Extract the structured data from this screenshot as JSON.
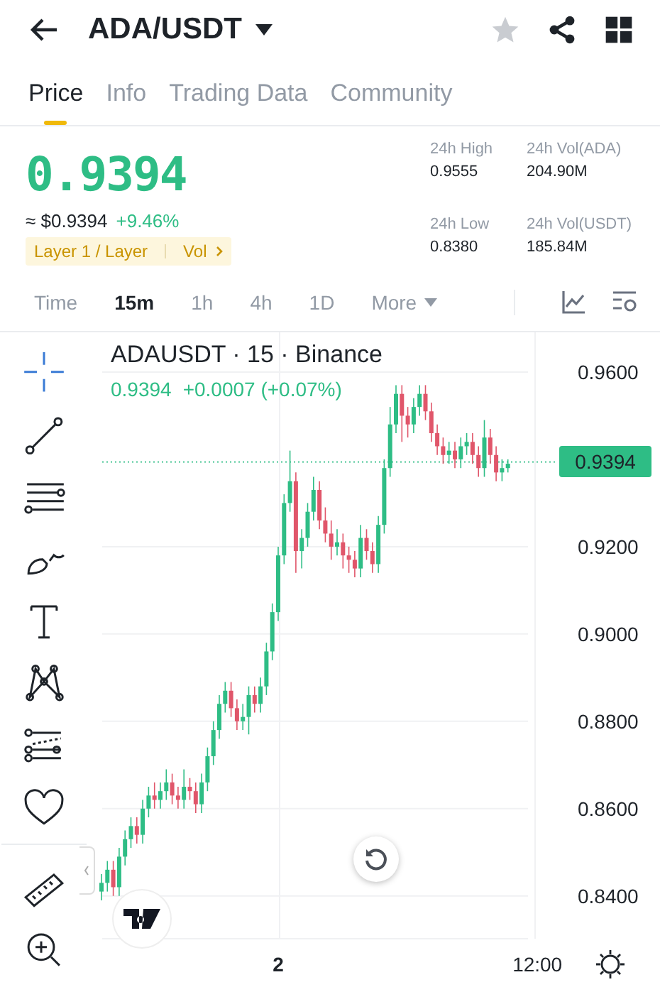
{
  "header": {
    "title": "ADA/USDT",
    "favorite": false
  },
  "tabs": [
    {
      "label": "Price",
      "selected": true
    },
    {
      "label": "Info",
      "selected": false
    },
    {
      "label": "Trading Data",
      "selected": false
    },
    {
      "label": "Community",
      "selected": false
    }
  ],
  "price": {
    "last": "0.9394",
    "usd": "≈ $0.9394",
    "change": "+9.46%",
    "tag": "Layer 1 / Layer",
    "tag_link": "Vol"
  },
  "stats": [
    {
      "label": "24h High",
      "value": "0.9555"
    },
    {
      "label": "24h Vol(ADA)",
      "value": "204.90M"
    },
    {
      "label": "24h Low",
      "value": "0.8380"
    },
    {
      "label": "24h Vol(USDT)",
      "value": "185.84M"
    }
  ],
  "intervals": [
    {
      "label": "Time",
      "selected": false
    },
    {
      "label": "15m",
      "selected": true
    },
    {
      "label": "1h",
      "selected": false
    },
    {
      "label": "4h",
      "selected": false
    },
    {
      "label": "1D",
      "selected": false
    },
    {
      "label": "More",
      "selected": false
    }
  ],
  "chart": {
    "title": "ADAUSDT · 15 · Binance",
    "legend_price": "0.9394",
    "legend_change": "+0.0007 (+0.07%)",
    "chart_data": {
      "type": "candlestick",
      "categories": [
        null,
        null,
        null,
        null,
        null,
        null,
        null,
        null,
        null,
        null,
        null,
        null,
        null,
        null,
        null,
        null,
        null,
        null,
        null,
        null,
        null,
        null,
        null,
        null,
        null,
        null,
        null,
        null,
        null,
        null,
        "2",
        null,
        null,
        null,
        null,
        null,
        null,
        null,
        null,
        null,
        null,
        null,
        null,
        null,
        null,
        null,
        null,
        null,
        null,
        null,
        null,
        null,
        null,
        null,
        null,
        null,
        null,
        null,
        null,
        null,
        null,
        null,
        null,
        null,
        null,
        null,
        null,
        null,
        null,
        null,
        null,
        null,
        null,
        null,
        "12:00"
      ],
      "ohlc": [
        [
          0.841,
          0.845,
          0.839,
          0.843
        ],
        [
          0.843,
          0.848,
          0.841,
          0.846
        ],
        [
          0.846,
          0.848,
          0.84,
          0.842
        ],
        [
          0.842,
          0.851,
          0.84,
          0.849
        ],
        [
          0.849,
          0.855,
          0.847,
          0.853
        ],
        [
          0.853,
          0.858,
          0.851,
          0.856
        ],
        [
          0.856,
          0.858,
          0.852,
          0.854
        ],
        [
          0.854,
          0.862,
          0.852,
          0.86
        ],
        [
          0.86,
          0.865,
          0.858,
          0.863
        ],
        [
          0.863,
          0.866,
          0.86,
          0.862
        ],
        [
          0.862,
          0.866,
          0.86,
          0.864
        ],
        [
          0.864,
          0.869,
          0.862,
          0.866
        ],
        [
          0.866,
          0.868,
          0.861,
          0.863
        ],
        [
          0.863,
          0.865,
          0.86,
          0.862
        ],
        [
          0.862,
          0.869,
          0.86,
          0.865
        ],
        [
          0.865,
          0.867,
          0.862,
          0.864
        ],
        [
          0.864,
          0.866,
          0.859,
          0.861
        ],
        [
          0.861,
          0.868,
          0.859,
          0.866
        ],
        [
          0.866,
          0.874,
          0.864,
          0.872
        ],
        [
          0.872,
          0.88,
          0.87,
          0.878
        ],
        [
          0.878,
          0.886,
          0.876,
          0.884
        ],
        [
          0.884,
          0.889,
          0.882,
          0.887
        ],
        [
          0.887,
          0.889,
          0.881,
          0.883
        ],
        [
          0.883,
          0.885,
          0.878,
          0.88
        ],
        [
          0.88,
          0.884,
          0.878,
          0.881
        ],
        [
          0.881,
          0.888,
          0.877,
          0.886
        ],
        [
          0.886,
          0.888,
          0.882,
          0.884
        ],
        [
          0.884,
          0.89,
          0.882,
          0.888
        ],
        [
          0.888,
          0.898,
          0.886,
          0.896
        ],
        [
          0.896,
          0.907,
          0.894,
          0.905
        ],
        [
          0.905,
          0.92,
          0.903,
          0.918
        ],
        [
          0.918,
          0.932,
          0.916,
          0.93
        ],
        [
          0.93,
          0.942,
          0.928,
          0.935
        ],
        [
          0.935,
          0.937,
          0.914,
          0.919
        ],
        [
          0.919,
          0.924,
          0.915,
          0.922
        ],
        [
          0.922,
          0.93,
          0.92,
          0.928
        ],
        [
          0.928,
          0.936,
          0.926,
          0.933
        ],
        [
          0.933,
          0.935,
          0.924,
          0.926
        ],
        [
          0.926,
          0.929,
          0.921,
          0.923
        ],
        [
          0.923,
          0.926,
          0.917,
          0.92
        ],
        [
          0.92,
          0.924,
          0.918,
          0.921
        ],
        [
          0.921,
          0.923,
          0.915,
          0.918
        ],
        [
          0.918,
          0.92,
          0.914,
          0.917
        ],
        [
          0.917,
          0.919,
          0.913,
          0.915
        ],
        [
          0.915,
          0.925,
          0.913,
          0.922
        ],
        [
          0.922,
          0.924,
          0.917,
          0.919
        ],
        [
          0.919,
          0.921,
          0.914,
          0.916
        ],
        [
          0.916,
          0.927,
          0.914,
          0.925
        ],
        [
          0.925,
          0.94,
          0.923,
          0.938
        ],
        [
          0.938,
          0.952,
          0.936,
          0.948
        ],
        [
          0.948,
          0.957,
          0.946,
          0.955
        ],
        [
          0.955,
          0.957,
          0.944,
          0.95
        ],
        [
          0.95,
          0.952,
          0.945,
          0.948
        ],
        [
          0.948,
          0.954,
          0.946,
          0.952
        ],
        [
          0.952,
          0.957,
          0.95,
          0.955
        ],
        [
          0.955,
          0.957,
          0.949,
          0.951
        ],
        [
          0.951,
          0.953,
          0.944,
          0.946
        ],
        [
          0.946,
          0.948,
          0.941,
          0.943
        ],
        [
          0.943,
          0.945,
          0.939,
          0.941
        ],
        [
          0.941,
          0.944,
          0.939,
          0.942
        ],
        [
          0.942,
          0.944,
          0.938,
          0.94
        ],
        [
          0.94,
          0.945,
          0.938,
          0.943
        ],
        [
          0.943,
          0.946,
          0.941,
          0.944
        ],
        [
          0.944,
          0.946,
          0.939,
          0.941
        ],
        [
          0.941,
          0.943,
          0.936,
          0.938
        ],
        [
          0.938,
          0.949,
          0.936,
          0.945
        ],
        [
          0.945,
          0.947,
          0.939,
          0.941
        ],
        [
          0.941,
          0.943,
          0.935,
          0.937
        ],
        [
          0.937,
          0.94,
          0.935,
          0.938
        ],
        [
          0.938,
          0.94,
          0.937,
          0.939
        ],
        null,
        null,
        null,
        null,
        null
      ],
      "ylim": [
        0.8302,
        0.9691
      ],
      "grid": true,
      "ref_lines": [
        {
          "axis": "y",
          "value": 0.9394,
          "label": "0.9394",
          "color": "#2ebd85"
        }
      ],
      "yticks": [
        {
          "value": 0.96,
          "label": "0.9600"
        },
        {
          "value": 0.92,
          "label": "0.9200"
        },
        {
          "value": 0.9,
          "label": "0.9000"
        },
        {
          "value": 0.88,
          "label": "0.8800"
        },
        {
          "value": 0.86,
          "label": "0.8600"
        },
        {
          "value": 0.84,
          "label": "0.8400"
        }
      ]
    }
  }
}
